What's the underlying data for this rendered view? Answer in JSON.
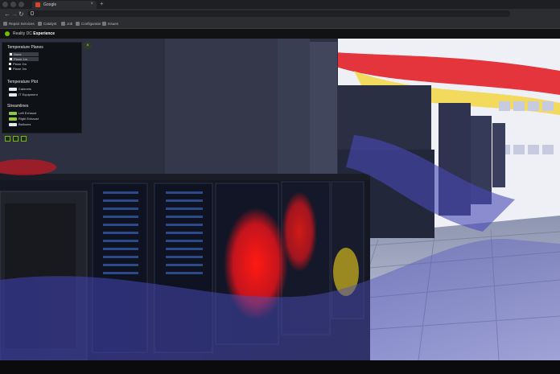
{
  "browser": {
    "tab_title": "Google",
    "tab_close": "×",
    "new_tab": "+",
    "nav": {
      "back": "←",
      "forward": "→",
      "reload": "↻"
    }
  },
  "bookmarks": [
    "Repair Services",
    "Catalyst",
    "Job",
    "Configurator",
    "Issues"
  ],
  "app": {
    "brand": "Reality DC",
    "title": "Experience"
  },
  "panel": {
    "close_label": "×",
    "temperature_planes": {
      "heading": "Temperature Planes",
      "options": [
        "None",
        "Plane 1m",
        "Plane 2m",
        "Plane 3m"
      ],
      "selected_index": 0
    },
    "temperature_plot": {
      "heading": "Temperature Plot",
      "options": [
        "Cabinets",
        "IT Equipment"
      ]
    },
    "streamlines": {
      "heading": "Streamlines",
      "options": [
        "Left Exhaust",
        "Right Exhaust",
        "Balloons"
      ]
    }
  },
  "colors": {
    "accent": "#76b900",
    "hot": "#e0141a",
    "warm": "#f2d21b",
    "cool": "#4a4ab8",
    "rack": "#2e3140"
  },
  "icons": [
    "back-arrow-icon",
    "forward-arrow-icon",
    "reload-icon",
    "lock-icon",
    "nvidia-logo-icon",
    "close-icon",
    "select-tool-icon",
    "grid-tool-icon",
    "settings-tool-icon"
  ]
}
